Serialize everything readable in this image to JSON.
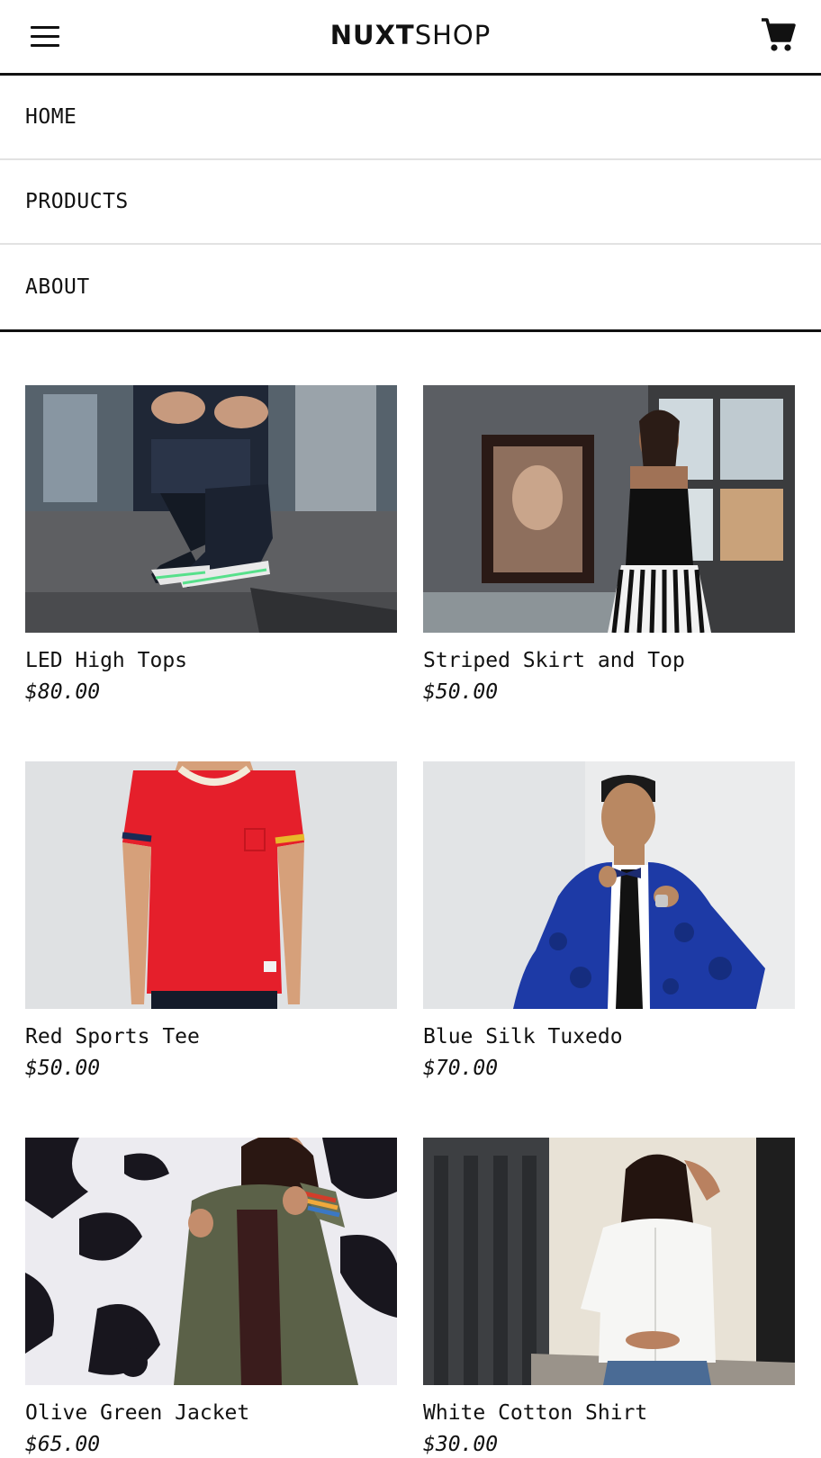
{
  "header": {
    "logo_bold": "NUXT",
    "logo_light": "SHOP",
    "menu_icon": "hamburger-menu-icon",
    "cart_icon": "shopping-cart-icon"
  },
  "nav": {
    "items": [
      {
        "label": "HOME"
      },
      {
        "label": "PRODUCTS"
      },
      {
        "label": "ABOUT"
      }
    ]
  },
  "products": [
    {
      "name": "LED High Tops",
      "price": "$80.00"
    },
    {
      "name": "Striped Skirt and Top",
      "price": "$50.00"
    },
    {
      "name": "Red Sports Tee",
      "price": "$50.00"
    },
    {
      "name": "Blue Silk Tuxedo",
      "price": "$70.00"
    },
    {
      "name": "Olive Green Jacket",
      "price": "$65.00"
    },
    {
      "name": "White Cotton Shirt",
      "price": "$30.00"
    }
  ],
  "colors": {
    "text": "#111111",
    "divider": "#e2e2e2",
    "tee_red": "#e51f2b",
    "tuxedo_blue": "#1d3aa6",
    "jacket_olive": "#5b6148"
  }
}
